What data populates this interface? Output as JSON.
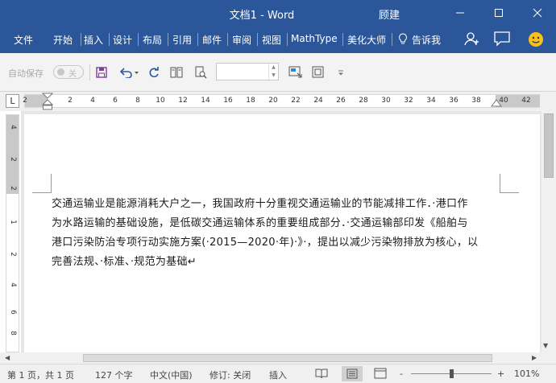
{
  "window": {
    "title": "文档1 - Word",
    "user": "顾建",
    "controls": {
      "minimize": "minimize-icon",
      "maximize": "maximize-icon",
      "close": "close-icon"
    }
  },
  "ribbon": {
    "tabs": [
      "文件",
      "开始",
      "插入",
      "设计",
      "布局",
      "引用",
      "邮件",
      "审阅",
      "视图",
      "MathType",
      "美化大师"
    ],
    "tell_me": "告诉我",
    "icons": [
      "lightbulb-icon",
      "account-icon",
      "comment-icon",
      "smiley-icon"
    ]
  },
  "qat": {
    "autosave_label": "自动保存",
    "autosave_state": "关",
    "font_size_value": "",
    "icons": [
      "save-icon",
      "undo-icon",
      "redo-icon",
      "columns-icon",
      "print-preview-icon",
      "text-box-icon",
      "frame-icon",
      "customize-icon"
    ]
  },
  "ruler": {
    "corner": "L",
    "marks": [
      "2",
      "2",
      "4",
      "6",
      "8",
      "10",
      "12",
      "14",
      "16",
      "18",
      "20",
      "22",
      "24",
      "26",
      "28",
      "30",
      "32",
      "34",
      "36",
      "38",
      "40",
      "42"
    ],
    "vertical_marks": [
      "4",
      "2",
      "2",
      "1",
      "2",
      "4",
      "6",
      "8"
    ]
  },
  "document": {
    "lines": [
      "交通运输业是能源消耗大户之一，我国政府十分重视交通运输业的节能减排工作．·港口作",
      "为水路运输的基础设施，是低碳交通运输体系的重要组成部分．·交通运输部印发《船舶与",
      "港口污染防治专项行动实施方案(·2015—2020·年)·》·，提出以减少污染物排放为核心，以",
      "完善法规、·标准、·规范为基础↵"
    ]
  },
  "status": {
    "page": "第 1 页，共 1 页",
    "words": "127 个字",
    "language": "中文(中国)",
    "track_changes": "修订: 关闭",
    "mode": "插入",
    "minus": "-",
    "plus": "+",
    "zoom": "101%",
    "zoom_level_percent": 101
  },
  "colors": {
    "accent": "#2b579a",
    "smiley": "#f7c11b"
  }
}
